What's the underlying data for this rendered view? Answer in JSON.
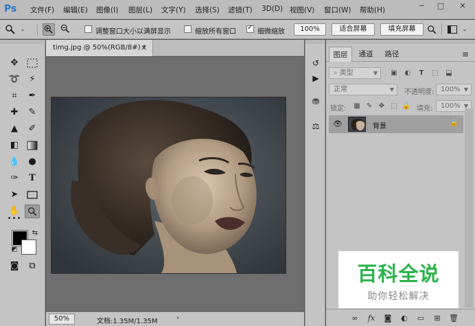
{
  "app": {
    "logo": "Ps"
  },
  "menu": [
    "文件(F)",
    "编辑(E)",
    "图像(I)",
    "图层(L)",
    "文字(Y)",
    "选择(S)",
    "滤镜(T)",
    "3D(D)",
    "视图(V)",
    "窗口(W)",
    "帮助(H)"
  ],
  "window_controls": {
    "minimize": "─",
    "maximize": "□",
    "close": "✕"
  },
  "options_bar": {
    "resize_windows_label": "调整窗口大小以满屏显示",
    "resize_windows_checked": false,
    "zoom_all_label": "缩放所有窗口",
    "zoom_all_checked": false,
    "scrubby_zoom_label": "细微缩放",
    "scrubby_zoom_checked": true,
    "actual_pixels_btn": "100%",
    "fit_screen_btn": "适合屏幕",
    "fill_screen_btn": "填充屏幕"
  },
  "document": {
    "tab_title": "timg.jpg @ 50%(RGB/8#) *",
    "tab_close": "×",
    "zoom": "50%",
    "doc_info": "文档:1.35M/1.35M",
    "status_arrow": "›"
  },
  "layers_panel": {
    "tabs": [
      "图层",
      "通道",
      "路径"
    ],
    "active_tab": "图层",
    "filter_kind": "类型",
    "blend_mode": "正常",
    "opacity_label": "不透明度:",
    "opacity_value": "100%",
    "lock_label": "锁定:",
    "fill_label": "填充:",
    "fill_value": "100%",
    "layers": [
      {
        "name": "背景",
        "visible": true,
        "locked": true
      }
    ]
  },
  "watermark": {
    "title": "百科全说",
    "subtitle": "助你轻松解决",
    "color": "#2bb34a"
  }
}
